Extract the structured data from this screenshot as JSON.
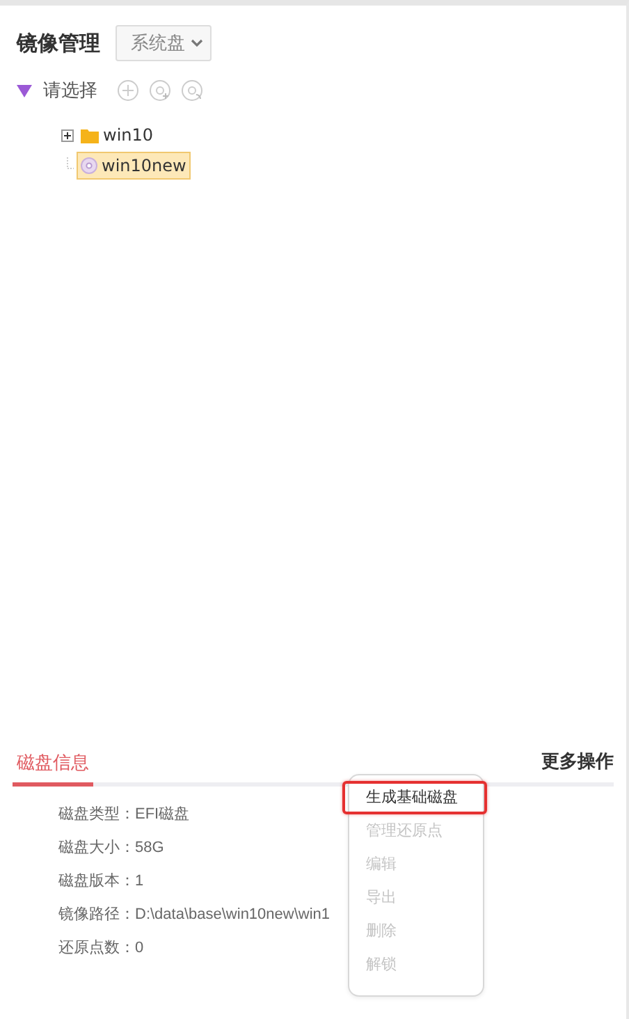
{
  "header": {
    "title": "镜像管理",
    "dropdown": "系统盘"
  },
  "tree": {
    "label": "请选择",
    "expanded": true,
    "nodes": [
      {
        "label": "win10",
        "kind": "folder",
        "expanded": false,
        "selected": false
      },
      {
        "label": "win10new",
        "kind": "disk",
        "selected": true
      }
    ]
  },
  "tabs": [
    {
      "label": "磁盘信息",
      "selected": true
    }
  ],
  "more_actions": "更多操作",
  "info": [
    {
      "label": "磁盘类型：",
      "value": "EFI磁盘"
    },
    {
      "label": "磁盘大小：",
      "value": "58G"
    },
    {
      "label": "磁盘版本：",
      "value": "1"
    },
    {
      "label": "镜像路径：",
      "value": "D:\\data\\base\\win10new\\win1"
    },
    {
      "label": "还原点数：",
      "value": "0"
    }
  ],
  "menu": [
    {
      "label": "生成基础磁盘",
      "disabled": false,
      "selected": true
    },
    {
      "label": "管理还原点",
      "disabled": true,
      "selected": false
    },
    {
      "label": "编辑",
      "disabled": true,
      "selected": false
    },
    {
      "label": "导出",
      "disabled": true,
      "selected": false
    },
    {
      "label": "删除",
      "disabled": true,
      "selected": false
    },
    {
      "label": "解锁",
      "disabled": true,
      "selected": false
    }
  ]
}
